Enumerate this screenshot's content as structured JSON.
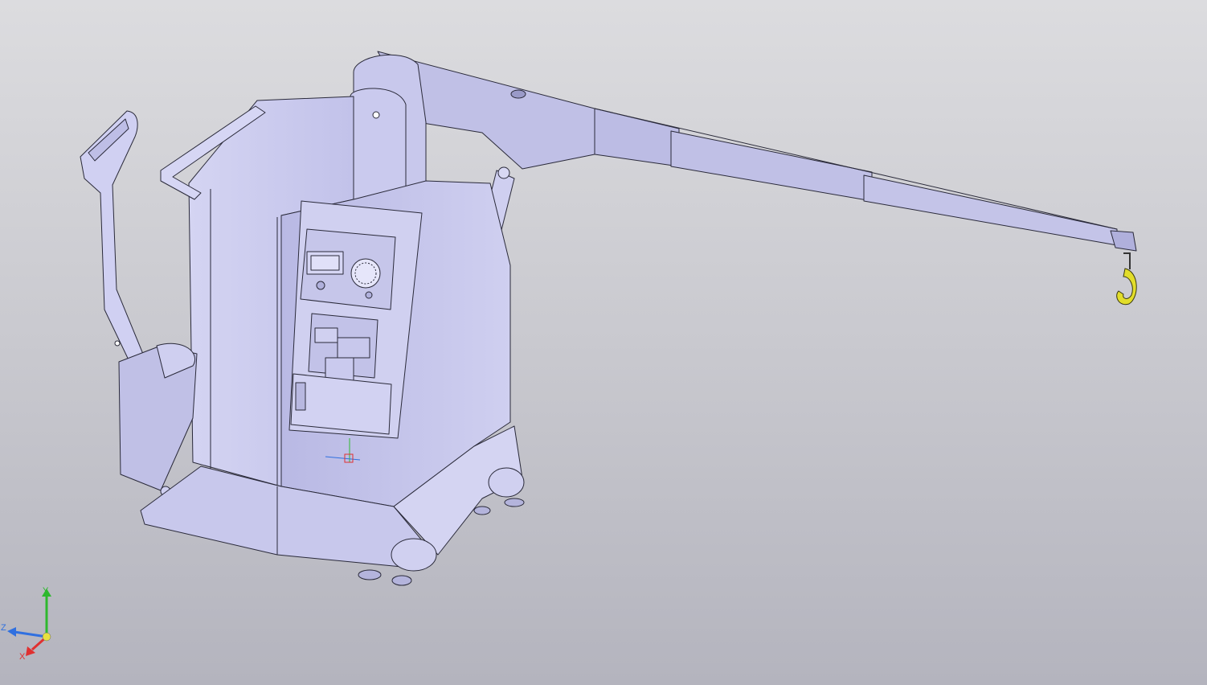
{
  "viewport": {
    "background_top": "#dcdcdf",
    "background_bottom": "#b4b4be",
    "model_fill": "#c4c4e8",
    "model_dark_fill": "#a8a8d4",
    "model_stroke": "#2a2a3a",
    "hook_color": "#e2dd2a"
  },
  "triad": {
    "x_label": "X",
    "y_label": "Y",
    "z_label": "Z",
    "x_color": "#e03030",
    "y_color": "#2eb82e",
    "z_color": "#3070e0",
    "origin_color": "#e8e040"
  }
}
